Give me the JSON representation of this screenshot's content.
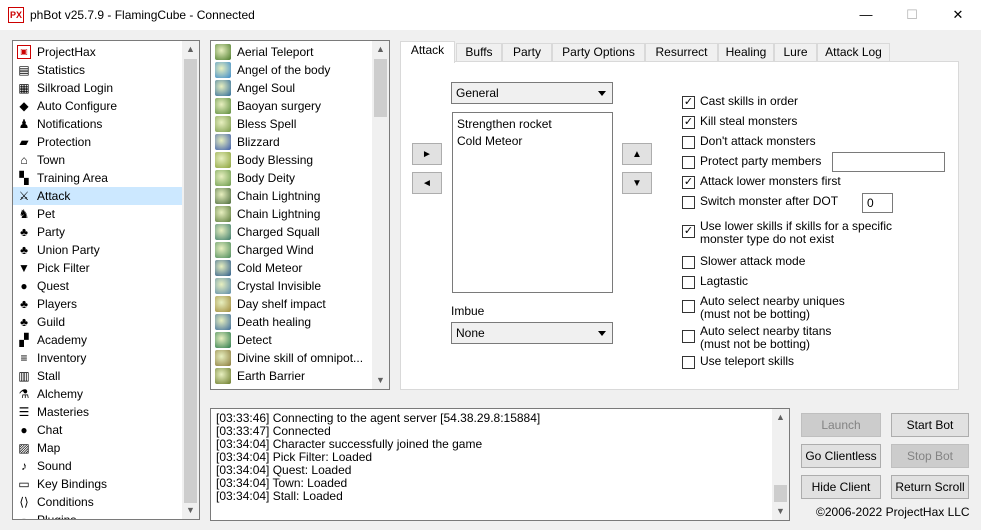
{
  "window": {
    "title": "phBot v25.7.9 - FlamingCube - Connected",
    "icon_text": "PX",
    "minimize": "—",
    "maximize": "☐",
    "close": "✕"
  },
  "sidebar": {
    "items": [
      {
        "label": "ProjectHax",
        "icon": "projecthax-icon",
        "glyph": "▣"
      },
      {
        "label": "Statistics",
        "icon": "statistics-icon",
        "glyph": "▤"
      },
      {
        "label": "Silkroad Login",
        "icon": "login-icon",
        "glyph": "▦"
      },
      {
        "label": "Auto Configure",
        "icon": "auto-configure-icon",
        "glyph": "◆"
      },
      {
        "label": "Notifications",
        "icon": "notifications-icon",
        "glyph": "♟"
      },
      {
        "label": "Protection",
        "icon": "protection-icon",
        "glyph": "▰"
      },
      {
        "label": "Town",
        "icon": "town-icon",
        "glyph": "⌂"
      },
      {
        "label": "Training Area",
        "icon": "training-area-icon",
        "glyph": "▚"
      },
      {
        "label": "Attack",
        "icon": "attack-icon",
        "glyph": "⚔"
      },
      {
        "label": "Pet",
        "icon": "pet-icon",
        "glyph": "♞"
      },
      {
        "label": "Party",
        "icon": "party-icon",
        "glyph": "♣"
      },
      {
        "label": "Union Party",
        "icon": "union-party-icon",
        "glyph": "♣"
      },
      {
        "label": "Pick Filter",
        "icon": "pick-filter-icon",
        "glyph": "▼"
      },
      {
        "label": "Quest",
        "icon": "quest-icon",
        "glyph": "●"
      },
      {
        "label": "Players",
        "icon": "players-icon",
        "glyph": "♣"
      },
      {
        "label": "Guild",
        "icon": "guild-icon",
        "glyph": "♣"
      },
      {
        "label": "Academy",
        "icon": "academy-icon",
        "glyph": "▞"
      },
      {
        "label": "Inventory",
        "icon": "inventory-icon",
        "glyph": "≡"
      },
      {
        "label": "Stall",
        "icon": "stall-icon",
        "glyph": "▥"
      },
      {
        "label": "Alchemy",
        "icon": "alchemy-icon",
        "glyph": "⚗"
      },
      {
        "label": "Masteries",
        "icon": "masteries-icon",
        "glyph": "☰"
      },
      {
        "label": "Chat",
        "icon": "chat-icon",
        "glyph": "●"
      },
      {
        "label": "Map",
        "icon": "map-icon",
        "glyph": "▨"
      },
      {
        "label": "Sound",
        "icon": "sound-icon",
        "glyph": "♪"
      },
      {
        "label": "Key Bindings",
        "icon": "key-bindings-icon",
        "glyph": "▭"
      },
      {
        "label": "Conditions",
        "icon": "conditions-icon",
        "glyph": "⟨⟩"
      },
      {
        "label": "Plugins",
        "icon": "plugins-icon",
        "glyph": "▪"
      }
    ],
    "selected_index": 8
  },
  "skills": {
    "items": [
      {
        "label": "Aerial Teleport",
        "color": "#4a7a2a"
      },
      {
        "label": "Angel of the body",
        "color": "#3a8acb"
      },
      {
        "label": "Angel Soul",
        "color": "#2d6a9a"
      },
      {
        "label": "Baoyan surgery",
        "color": "#5a8a3a"
      },
      {
        "label": "Bless Spell",
        "color": "#7a9a4a"
      },
      {
        "label": "Blizzard",
        "color": "#3a5aaa"
      },
      {
        "label": "Body Blessing",
        "color": "#8aa23a"
      },
      {
        "label": "Body Deity",
        "color": "#6a9a4a"
      },
      {
        "label": "Chain Lightning",
        "color": "#4a6a3a"
      },
      {
        "label": "Chain Lightning",
        "color": "#5a7a3a"
      },
      {
        "label": "Charged Squall",
        "color": "#3a7a6a"
      },
      {
        "label": "Charged Wind",
        "color": "#4a8a5a"
      },
      {
        "label": "Cold Meteor",
        "color": "#2a5a8a"
      },
      {
        "label": "Crystal Invisible",
        "color": "#5a8aaa"
      },
      {
        "label": "Day shelf impact",
        "color": "#a08a3a"
      },
      {
        "label": "Death healing",
        "color": "#3a6a9a"
      },
      {
        "label": "Detect",
        "color": "#2a7a4a"
      },
      {
        "label": "Divine skill of omnipot...",
        "color": "#8a7a3a"
      },
      {
        "label": "Earth Barrier",
        "color": "#6a7a2a"
      }
    ]
  },
  "tabs": [
    {
      "label": "Attack",
      "active": true
    },
    {
      "label": "Buffs"
    },
    {
      "label": "Party"
    },
    {
      "label": "Party Options"
    },
    {
      "label": "Resurrect"
    },
    {
      "label": "Healing"
    },
    {
      "label": "Lure"
    },
    {
      "label": "Attack Log"
    }
  ],
  "attack": {
    "group_select": "General",
    "selected_skills": [
      "Strengthen rocket",
      "Cold Meteor"
    ],
    "add_label": "►",
    "remove_label": "◄",
    "up_label": "▲",
    "down_label": "▼",
    "imbue_label": "Imbue",
    "imbue_select": "None",
    "options": [
      {
        "label": "Cast skills in order",
        "checked": true
      },
      {
        "label": "Kill steal monsters",
        "checked": true
      },
      {
        "label": "Don't attack monsters",
        "checked": false
      },
      {
        "label": "Protect party members",
        "checked": false
      },
      {
        "label": "Attack lower monsters first",
        "checked": true
      },
      {
        "label": "Switch monster after DOT",
        "checked": false
      },
      {
        "label": "Use lower skills if skills for a specific",
        "label2": "monster type do not exist",
        "checked": true
      },
      {
        "label": "Slower attack mode",
        "checked": false
      },
      {
        "label": "Lagtastic",
        "checked": false
      },
      {
        "label": "Auto select nearby uniques",
        "label2": "(must not be botting)",
        "checked": false
      },
      {
        "label": "Auto select nearby titans",
        "label2": "(must not be botting)",
        "checked": false
      },
      {
        "label": "Use teleport skills",
        "checked": false
      }
    ],
    "protect_party_value": "",
    "dot_value": "0"
  },
  "log": {
    "lines": [
      "[03:33:46] Connecting to the agent server [54.38.29.8:15884]",
      "[03:33:47] Connected",
      "[03:34:04] Character successfully joined the game",
      "[03:34:04] Pick Filter: Loaded",
      "[03:34:04] Quest: Loaded",
      "[03:34:04] Town: Loaded",
      "[03:34:04] Stall: Loaded"
    ]
  },
  "controls": {
    "launch": "Launch",
    "start_bot": "Start Bot",
    "go_clientless": "Go Clientless",
    "stop_bot": "Stop Bot",
    "hide_client": "Hide Client",
    "return_scroll": "Return Scroll",
    "copyright": "©2006-2022 ProjectHax LLC"
  }
}
